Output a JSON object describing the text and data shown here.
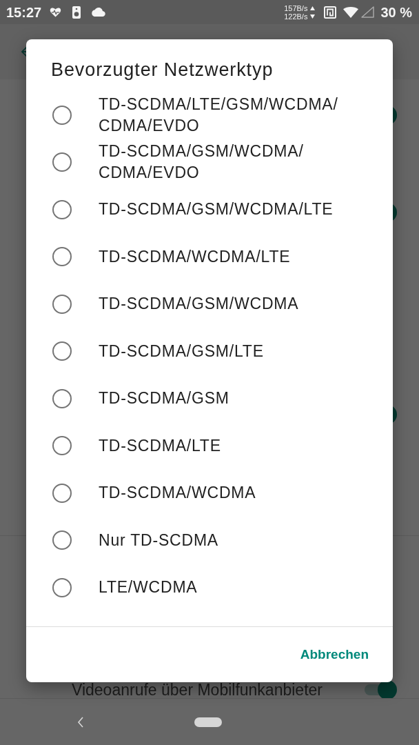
{
  "status_bar": {
    "time": "15:27",
    "upload_speed": "157B/s",
    "download_speed": "122B/s",
    "battery": "30 %"
  },
  "screen": {
    "settings": [
      {
        "on": true
      },
      {
        "on": true
      },
      {
        "on": true
      },
      {
        "label": "Videoanrufe über Mobilfunkanbieter",
        "on": true
      }
    ]
  },
  "dialog": {
    "title": "Bevorzugter Netzwerktyp",
    "options": [
      {
        "label": "TD-SCDMA/LTE/GSM/WCDMA/CDMA/EVDO",
        "selected": false
      },
      {
        "label": "TD-SCDMA/GSM/WCDMA/CDMA/EVDO",
        "selected": false
      },
      {
        "label": "TD-SCDMA/GSM/WCDMA/LTE",
        "selected": false
      },
      {
        "label": "TD-SCDMA/WCDMA/LTE",
        "selected": false
      },
      {
        "label": "TD-SCDMA/GSM/WCDMA",
        "selected": false
      },
      {
        "label": "TD-SCDMA/GSM/LTE",
        "selected": false
      },
      {
        "label": "TD-SCDMA/GSM",
        "selected": false
      },
      {
        "label": "TD-SCDMA/LTE",
        "selected": false
      },
      {
        "label": "TD-SCDMA/WCDMA",
        "selected": false
      },
      {
        "label": "Nur TD-SCDMA",
        "selected": false
      },
      {
        "label": "LTE/WCDMA",
        "selected": false
      }
    ],
    "buttons": [
      "Abbrechen"
    ]
  }
}
